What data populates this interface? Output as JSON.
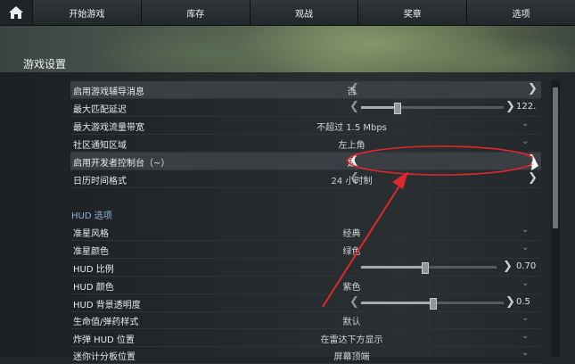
{
  "nav": {
    "tabs": [
      "开始游戏",
      "库存",
      "观战",
      "奖章",
      "选项"
    ]
  },
  "header": {
    "title": "游戏设置"
  },
  "settings": {
    "rows": [
      {
        "label": "启用游戏辅导消息",
        "value": "否",
        "control": "arrows"
      },
      {
        "label": "最大匹配延迟",
        "value": "122.",
        "control": "slider",
        "level": 0.25
      },
      {
        "label": "最大游戏流量带宽",
        "value": "不超过 1.5 Mbps",
        "control": "chevron"
      },
      {
        "label": "社区通知区域",
        "value": "左上角",
        "control": "chevron"
      },
      {
        "label": "启用开发者控制台（~）",
        "value": "是",
        "control": "arrows"
      },
      {
        "label": "日历时间格式",
        "value": "24 小时制",
        "control": "arrows"
      }
    ],
    "hud_section_title": "HUD 选项",
    "hud_rows": [
      {
        "label": "准星风格",
        "value": "经典",
        "control": "chevron"
      },
      {
        "label": "准星颜色",
        "value": "绿色",
        "control": "chevron"
      },
      {
        "label": "HUD 比例",
        "value": "0.70",
        "control": "slider",
        "level": 0.4
      },
      {
        "label": "HUD 颜色",
        "value": "紫色",
        "control": "chevron"
      },
      {
        "label": "HUD 背景透明度",
        "value": "0.5",
        "control": "slider",
        "level": 0.5
      },
      {
        "label": "生命值/弹药样式",
        "value": "默认",
        "control": "chevron"
      },
      {
        "label": "炸弹 HUD 位置",
        "value": "在雷达下方显示",
        "control": "chevron"
      },
      {
        "label": "迷你计分板位置",
        "value": "屏幕顶端",
        "control": "chevron"
      }
    ]
  },
  "arrow_glyphs": {
    "left": "❮",
    "right": "❯",
    "down": "⌄"
  },
  "colors": {
    "annotation": "#e0272b",
    "section": "#8fb4d8"
  }
}
